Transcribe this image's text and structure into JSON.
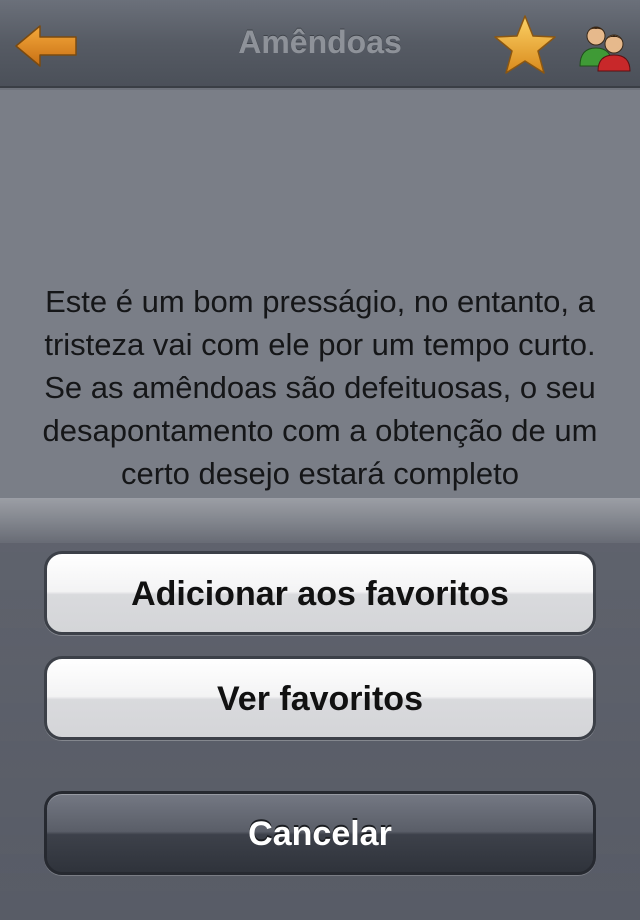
{
  "navbar": {
    "title": "Amêndoas",
    "back_icon": "back-arrow-icon",
    "favorite_icon": "star-icon",
    "share_icon": "users-icon"
  },
  "content": {
    "body_text": "Este é um bom presságio, no entanto, a tristeza vai com ele por um tempo curto. Se as amêndoas são defeituosas, o seu desapontamento com a obtenção de um certo desejo estará completo"
  },
  "action_sheet": {
    "add_favorites_label": "Adicionar aos favoritos",
    "view_favorites_label": "Ver favoritos",
    "cancel_label": "Cancelar"
  },
  "colors": {
    "accent_orange": "#e8962a",
    "navbar": "#5a5f68",
    "background": "#7a7e87"
  }
}
